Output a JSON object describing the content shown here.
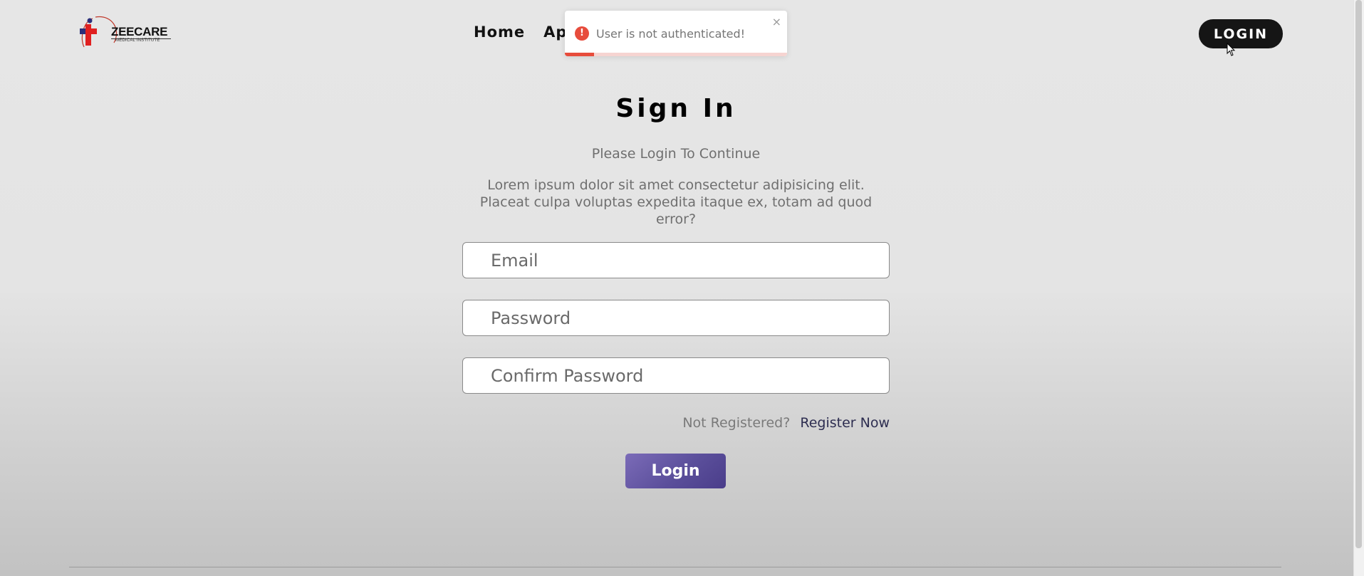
{
  "logo": {
    "name": "ZEECARE",
    "subtitle": "MEDICAL INSTITUTE"
  },
  "nav": {
    "home": "Home",
    "appointment": "Appointment"
  },
  "header": {
    "login_label": "LOGIN"
  },
  "toast": {
    "icon": "exclamation-icon",
    "message": "User is not authenticated!",
    "close": "×",
    "progress_fraction": 0.13,
    "color": "#e74c3c"
  },
  "form": {
    "title": "Sign In",
    "subtitle": "Please Login To Continue",
    "description": "Lorem ipsum dolor sit amet consectetur adipisicing elit. Placeat culpa voluptas expedita itaque ex, totam ad quod error?",
    "email_placeholder": "Email",
    "password_placeholder": "Password",
    "confirm_placeholder": "Confirm Password",
    "not_registered": "Not Registered?",
    "register_link": "Register Now",
    "submit_label": "Login"
  },
  "colors": {
    "accent": "#5b4f9b",
    "login_button": "#151515"
  }
}
